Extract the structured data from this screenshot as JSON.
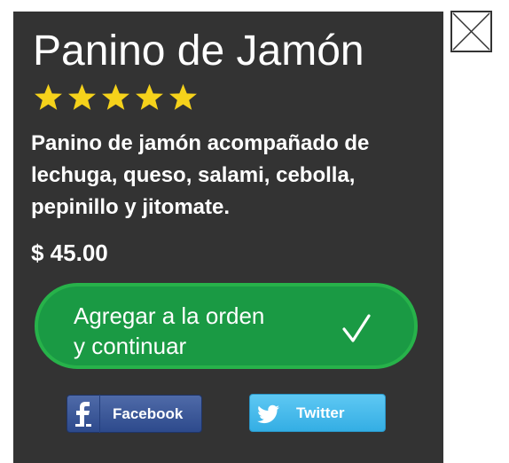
{
  "product": {
    "title": "Panino de Jamón",
    "rating": 5,
    "rating_max": 5,
    "description": "Panino de jamón acompañado de lechuga, queso, salami, cebolla, pepinillo y jitomate.",
    "price": "$ 45.00"
  },
  "actions": {
    "add_label_line1": "Agregar a la orden",
    "add_label_line2": "y continuar",
    "add_icon": "check-icon",
    "close_icon": "close-icon"
  },
  "share": {
    "facebook_label": "Facebook",
    "facebook_icon": "facebook-icon",
    "twitter_label": "Twitter",
    "twitter_icon": "twitter-icon"
  },
  "colors": {
    "card_background": "#333333",
    "star": "#f5d21b",
    "add_button": "#1a9a44",
    "add_button_border": "#27b24a",
    "facebook": "#3b5998",
    "twitter": "#4ab8ea"
  }
}
